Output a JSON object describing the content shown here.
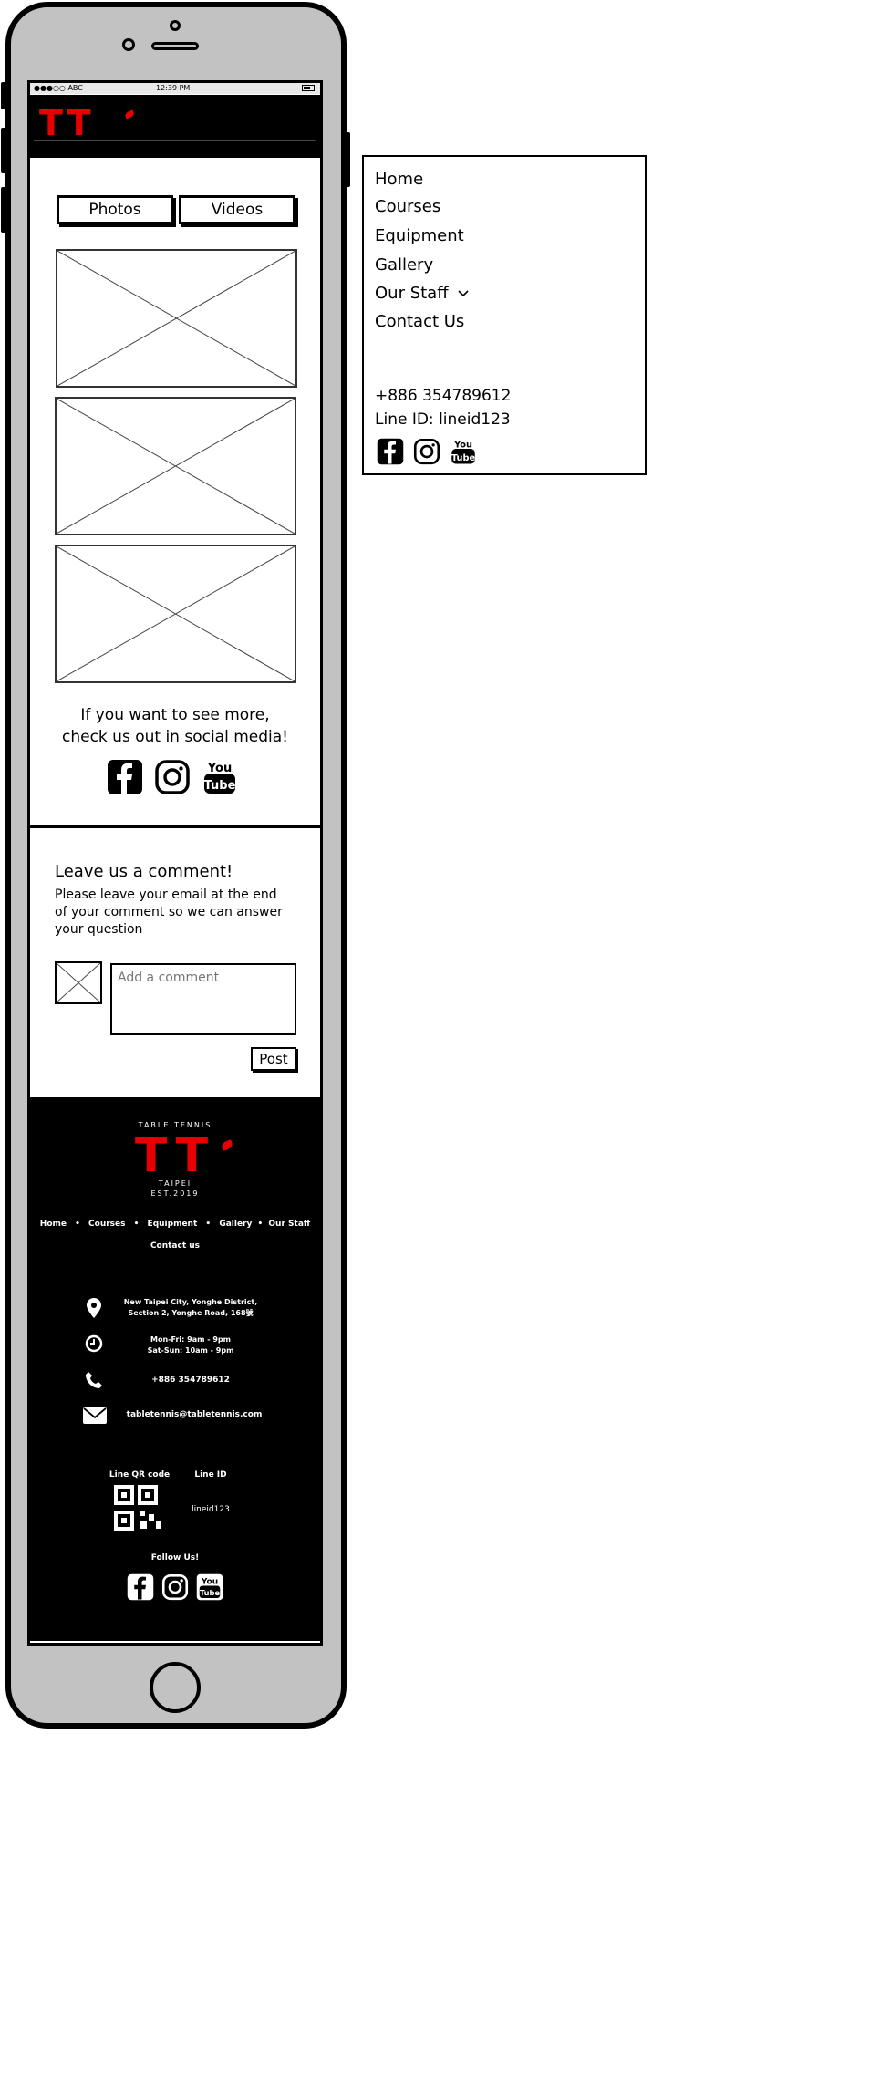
{
  "status_bar": {
    "carrier": "●●●○○ ABC",
    "time": "12:39 PM"
  },
  "header": {
    "logo_text": "TT"
  },
  "media": {
    "tabs": [
      {
        "label": "Photos"
      },
      {
        "label": "Videos"
      }
    ],
    "social_prompt_line1": "If you want to see more,",
    "social_prompt_line2": "check us out in social media!",
    "social_icons": [
      "facebook-icon",
      "instagram-icon",
      "youtube-icon"
    ]
  },
  "comment": {
    "title": "Leave us a comment!",
    "desc_line1": "Please leave your email at the end",
    "desc_line2": "of your comment so we can answer",
    "desc_line3": "your question",
    "placeholder": "Add a comment",
    "post_label": "Post"
  },
  "footer": {
    "brand_top": "TABLE TENNIS",
    "logo_text": "TT",
    "brand_city": "TAIPEI",
    "brand_est": "EST.2019",
    "nav": [
      "Home",
      "Courses",
      "Equipment",
      "Gallery",
      "Our Staff",
      "Contact us"
    ],
    "address_line1": "New Taipei City, Yonghe District,",
    "address_line2": "Section 2, Yonghe Road, 168號",
    "hours_line1": "Mon-Fri: 9am - 9pm",
    "hours_line2": "Sat-Sun: 10am - 9pm",
    "phone": "+886 354789612",
    "email": "tabletennis@tabletennis.com",
    "qr_label": "Line QR code",
    "line_id_label": "Line ID",
    "line_id_value": "lineid123",
    "follow_label": "Follow Us!"
  },
  "side_menu": {
    "items": [
      "Home",
      "Courses",
      "Equipment",
      "Gallery",
      "Our Staff",
      "Contact Us"
    ],
    "phone": "+886 354789612",
    "line_id": "Line ID: lineid123"
  },
  "colors": {
    "brand_red": "#e60000",
    "dark": "#000000",
    "frame": "#c2c2c2"
  }
}
